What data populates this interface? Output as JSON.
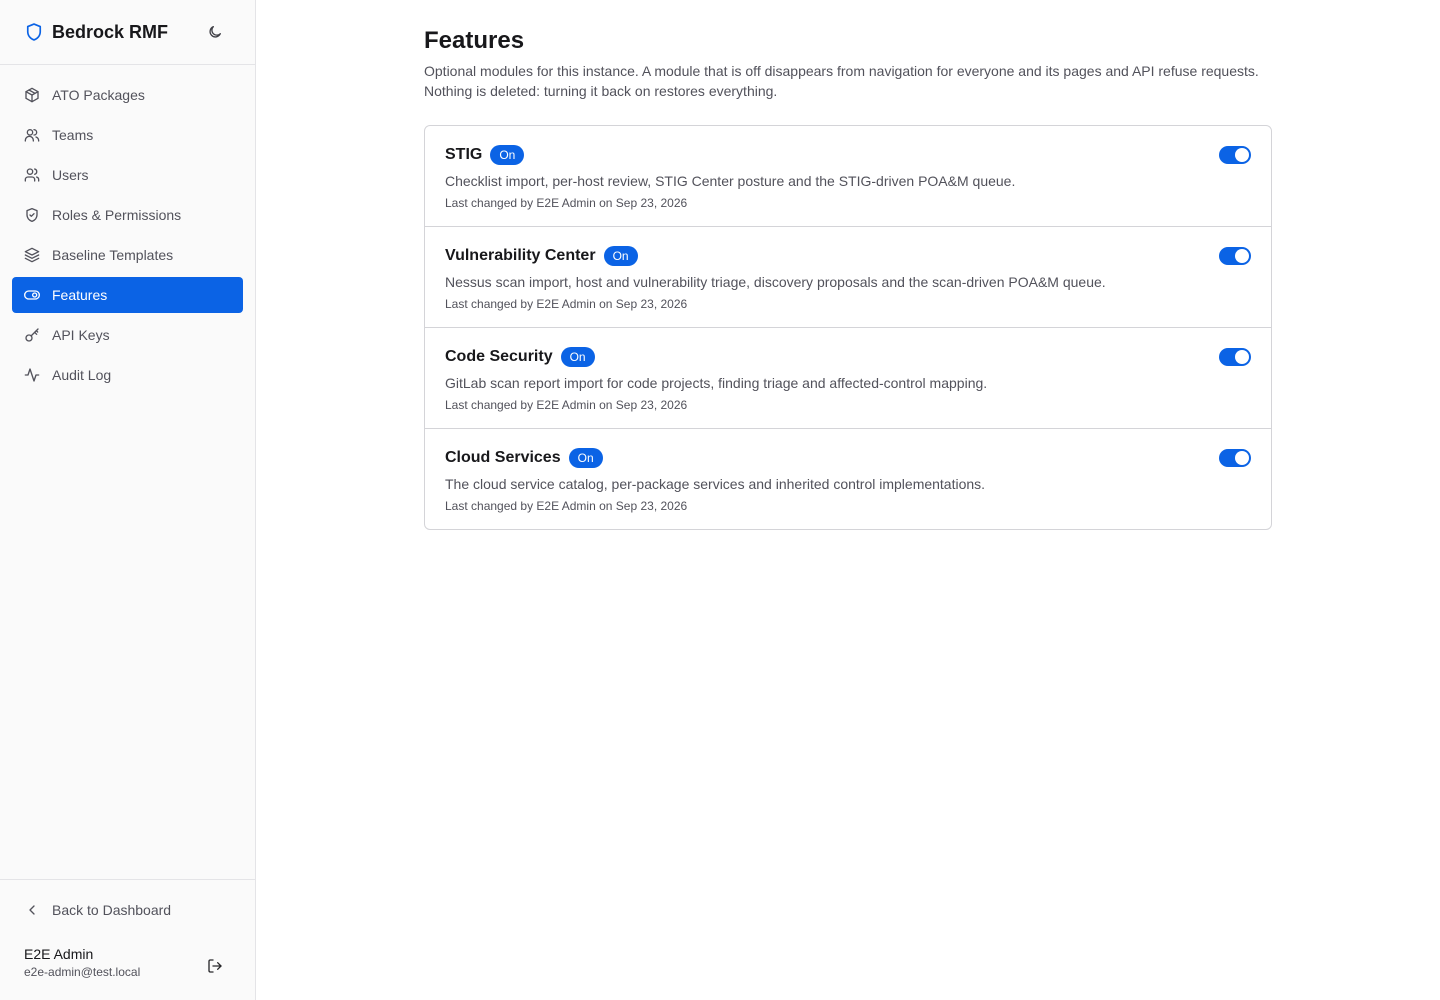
{
  "app": {
    "title": "Bedrock RMF",
    "brand_color": "#0b63e5",
    "icon": "shield-icon",
    "theme_toggle_icon": "moon-icon"
  },
  "sidebar": {
    "items": [
      {
        "label": "ATO Packages",
        "icon": "package-icon",
        "active": false
      },
      {
        "label": "Teams",
        "icon": "teams-icon",
        "active": false
      },
      {
        "label": "Users",
        "icon": "users-icon",
        "active": false
      },
      {
        "label": "Roles & Permissions",
        "icon": "shield-check-icon",
        "active": false
      },
      {
        "label": "Baseline Templates",
        "icon": "layers-icon",
        "active": false
      },
      {
        "label": "Features",
        "icon": "toggle-icon",
        "active": true
      },
      {
        "label": "API Keys",
        "icon": "key-icon",
        "active": false
      },
      {
        "label": "Audit Log",
        "icon": "activity-icon",
        "active": false
      }
    ],
    "back_label": "Back to Dashboard",
    "user": {
      "name": "E2E Admin",
      "email": "e2e-admin@test.local",
      "logout_icon": "logout-icon"
    }
  },
  "main": {
    "title": "Features",
    "description": "Optional modules for this instance. A module that is off disappears from navigation for everyone and its pages and API refuse requests. Nothing is deleted: turning it back on restores everything.",
    "features": [
      {
        "name": "STIG",
        "status": "On",
        "enabled": true,
        "description": "Checklist import, per-host review, STIG Center posture and the STIG-driven POA&M queue.",
        "meta": "Last changed by E2E Admin on Sep 23, 2026"
      },
      {
        "name": "Vulnerability Center",
        "status": "On",
        "enabled": true,
        "description": "Nessus scan import, host and vulnerability triage, discovery proposals and the scan-driven POA&M queue.",
        "meta": "Last changed by E2E Admin on Sep 23, 2026"
      },
      {
        "name": "Code Security",
        "status": "On",
        "enabled": true,
        "description": "GitLab scan report import for code projects, finding triage and affected-control mapping.",
        "meta": "Last changed by E2E Admin on Sep 23, 2026"
      },
      {
        "name": "Cloud Services",
        "status": "On",
        "enabled": true,
        "description": "The cloud service catalog, per-package services and inherited control implementations.",
        "meta": "Last changed by E2E Admin on Sep 23, 2026"
      }
    ]
  }
}
